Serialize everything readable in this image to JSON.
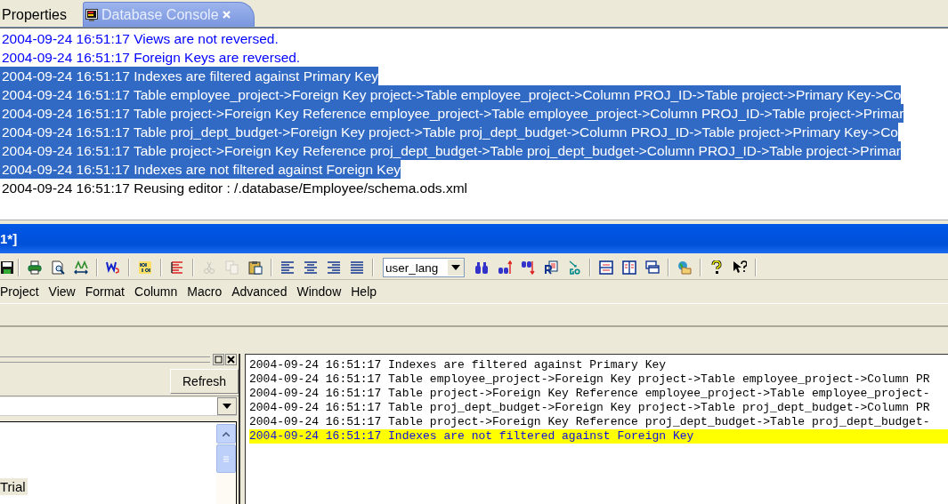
{
  "tabs": [
    {
      "label": "Properties",
      "selected": false,
      "closable": false
    },
    {
      "label": "Database Console",
      "selected": true,
      "closable": true
    }
  ],
  "console": {
    "lines": [
      {
        "text": "2004-09-24 16:51:17 Views are not reversed.",
        "selected": false,
        "kind": "info"
      },
      {
        "text": "2004-09-24 16:51:17 Foreign Keys are reversed.",
        "selected": false,
        "kind": "info"
      },
      {
        "text": "2004-09-24 16:51:17 Indexes are filtered against Primary Key",
        "selected": true
      },
      {
        "text": "2004-09-24 16:51:17 Table employee_project->Foreign Key project->Table employee_project->Column PROJ_ID->Table project->Primary Key->Co",
        "selected": true
      },
      {
        "text": "2004-09-24 16:51:17 Table project->Foreign Key Reference employee_project->Table employee_project->Column PROJ_ID->Table project->Primar",
        "selected": true
      },
      {
        "text": "2004-09-24 16:51:17 Table proj_dept_budget->Foreign Key project->Table proj_dept_budget->Column PROJ_ID->Table project->Primary Key->Co",
        "selected": true
      },
      {
        "text": "2004-09-24 16:51:17 Table project->Foreign Key Reference proj_dept_budget->Table proj_dept_budget->Column PROJ_ID->Table project->Primar",
        "selected": true
      },
      {
        "text": "2004-09-24 16:51:17 Indexes are not filtered against Foreign Key",
        "selected": true
      },
      {
        "text": "2004-09-24 16:51:17 Reusing editor : /.database/Employee/schema.ods.xml",
        "selected": false,
        "kind": "plain"
      }
    ]
  },
  "window": {
    "title": "1*]"
  },
  "toolbar": [
    {
      "kind": "button",
      "disabled": false
    },
    {
      "kind": "separator"
    },
    {
      "kind": "button",
      "disabled": false
    },
    {
      "kind": "button",
      "disabled": false
    },
    {
      "kind": "button",
      "disabled": false
    },
    {
      "kind": "separator"
    },
    {
      "kind": "button",
      "disabled": false
    },
    {
      "kind": "separator"
    },
    {
      "kind": "button",
      "disabled": false
    },
    {
      "kind": "separator"
    },
    {
      "kind": "button",
      "disabled": false
    },
    {
      "kind": "separator"
    },
    {
      "kind": "button",
      "disabled": true
    },
    {
      "kind": "button",
      "disabled": true
    },
    {
      "kind": "button",
      "disabled": false
    },
    {
      "kind": "separator"
    },
    {
      "kind": "button",
      "disabled": false
    },
    {
      "kind": "button",
      "disabled": false
    },
    {
      "kind": "button",
      "disabled": false
    },
    {
      "kind": "button",
      "disabled": false
    },
    {
      "kind": "separator"
    },
    {
      "kind": "combo",
      "value": "user_lang"
    },
    {
      "kind": "button",
      "disabled": false
    },
    {
      "kind": "button",
      "disabled": false
    },
    {
      "kind": "button",
      "disabled": false
    },
    {
      "kind": "button",
      "disabled": false
    },
    {
      "kind": "button",
      "disabled": false
    },
    {
      "kind": "separator"
    },
    {
      "kind": "button",
      "disabled": false
    },
    {
      "kind": "button",
      "disabled": false
    },
    {
      "kind": "button",
      "disabled": false
    },
    {
      "kind": "separator"
    },
    {
      "kind": "button",
      "disabled": false
    },
    {
      "kind": "separator"
    },
    {
      "kind": "button",
      "disabled": false
    },
    {
      "kind": "button",
      "disabled": false
    },
    {
      "kind": "separator"
    }
  ],
  "menu": [
    "Project",
    "View",
    "Format",
    "Column",
    "Macro",
    "Advanced",
    "Window",
    "Help"
  ],
  "left_panel": {
    "refresh_button": "Refresh",
    "list_items": [
      {
        "label": "Trial",
        "selected": true
      }
    ]
  },
  "log": {
    "lines": [
      {
        "text": "2004-09-24 16:51:17 Indexes are filtered against Primary Key",
        "highlighted": false
      },
      {
        "text": "2004-09-24 16:51:17 Table employee_project->Foreign Key project->Table employee_project->Column PR",
        "highlighted": false
      },
      {
        "text": "2004-09-24 16:51:17 Table project->Foreign Key Reference employee_project->Table employee_project-",
        "highlighted": false
      },
      {
        "text": "2004-09-24 16:51:17 Table proj_dept_budget->Foreign Key project->Table proj_dept_budget->Column PR",
        "highlighted": false
      },
      {
        "text": "2004-09-24 16:51:17 Table project->Foreign Key Reference proj_dept_budget->Table proj_dept_budget-",
        "highlighted": false
      },
      {
        "text": "2004-09-24 16:51:17 Indexes are not filtered against Foreign Key",
        "highlighted": true
      }
    ]
  }
}
